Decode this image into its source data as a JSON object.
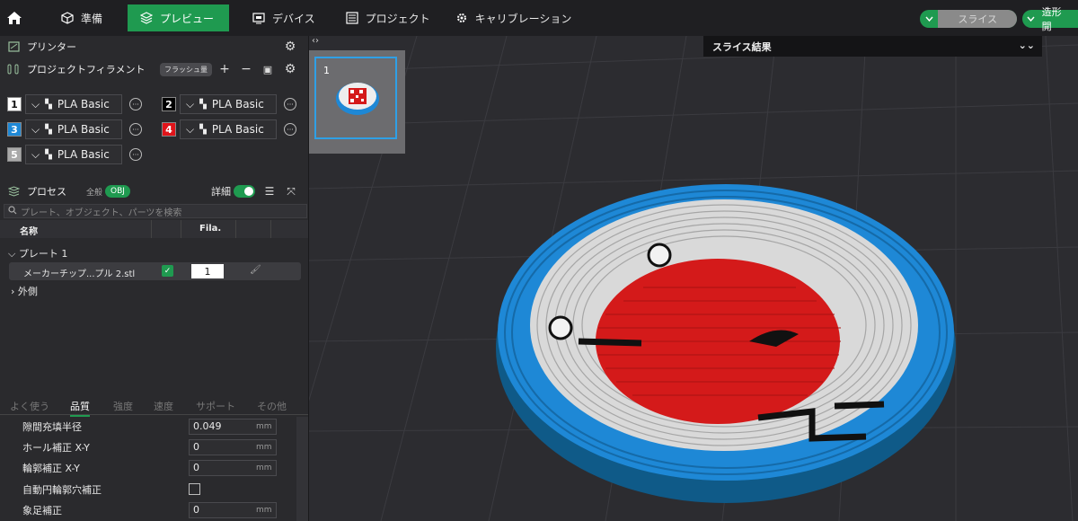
{
  "topbar": {
    "tabs": [
      {
        "label": "準備",
        "icon": "cube-icon"
      },
      {
        "label": "プレビュー",
        "icon": "layers-icon",
        "active": true
      },
      {
        "label": "デバイス",
        "icon": "device-icon"
      },
      {
        "label": "プロジェクト",
        "icon": "project-icon"
      },
      {
        "label": "キャリブレーション",
        "icon": "gear-icon"
      }
    ],
    "slice_button": "スライス",
    "print_button": "造形開"
  },
  "left": {
    "printer_title": "プリンター",
    "filament_title": "プロジェクトフィラメント",
    "flush_badge": "フラッシュ量",
    "filaments": [
      {
        "num": "1",
        "name": "PLA Basic",
        "color": "#ffffff"
      },
      {
        "num": "2",
        "name": "PLA Basic",
        "color": "#000000"
      },
      {
        "num": "3",
        "name": "PLA Basic",
        "color": "#1e88d6"
      },
      {
        "num": "4",
        "name": "PLA Basic",
        "color": "#e0141a"
      },
      {
        "num": "5",
        "name": "PLA Basic",
        "color": "#a9a9a9"
      }
    ],
    "process_title": "プロセス",
    "process_all": "全般",
    "process_obj": "OBJ",
    "detail_label": "詳細",
    "search_placeholder": "プレート、オブジェクト、パーツを検索",
    "table_headers": {
      "name": "名称",
      "fila": "Fila."
    },
    "tree": {
      "plate": "プレート 1",
      "object": "メーカーチップ...プル 2.stl",
      "object_fila": "1",
      "outer": "外側"
    },
    "settings_tabs": [
      "よく使う",
      "品質",
      "強度",
      "速度",
      "サポート",
      "その他"
    ],
    "active_settings_tab": "品質",
    "props": [
      {
        "label": "隙間充填半径",
        "value": "0.049",
        "unit": "mm"
      },
      {
        "label": "ホール補正 X-Y",
        "value": "0",
        "unit": "mm"
      },
      {
        "label": "輪郭補正 X-Y",
        "value": "0",
        "unit": "mm"
      },
      {
        "label": "自動円輪郭穴補正",
        "value": "",
        "unit": ""
      },
      {
        "label": "象足補正",
        "value": "0",
        "unit": "mm"
      }
    ]
  },
  "viewport": {
    "plate_number": "1",
    "slice_result_title": "スライス結果"
  }
}
